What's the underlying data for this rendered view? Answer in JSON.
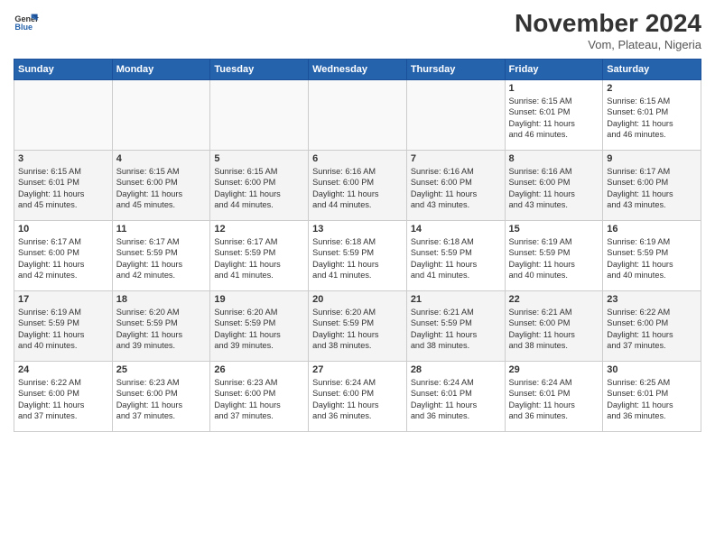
{
  "header": {
    "logo": {
      "general": "General",
      "blue": "Blue"
    },
    "month_title": "November 2024",
    "subtitle": "Vom, Plateau, Nigeria"
  },
  "weekdays": [
    "Sunday",
    "Monday",
    "Tuesday",
    "Wednesday",
    "Thursday",
    "Friday",
    "Saturday"
  ],
  "weeks": [
    [
      {
        "day": "",
        "info": ""
      },
      {
        "day": "",
        "info": ""
      },
      {
        "day": "",
        "info": ""
      },
      {
        "day": "",
        "info": ""
      },
      {
        "day": "",
        "info": ""
      },
      {
        "day": "1",
        "info": "Sunrise: 6:15 AM\nSunset: 6:01 PM\nDaylight: 11 hours\nand 46 minutes."
      },
      {
        "day": "2",
        "info": "Sunrise: 6:15 AM\nSunset: 6:01 PM\nDaylight: 11 hours\nand 46 minutes."
      }
    ],
    [
      {
        "day": "3",
        "info": "Sunrise: 6:15 AM\nSunset: 6:01 PM\nDaylight: 11 hours\nand 45 minutes."
      },
      {
        "day": "4",
        "info": "Sunrise: 6:15 AM\nSunset: 6:00 PM\nDaylight: 11 hours\nand 45 minutes."
      },
      {
        "day": "5",
        "info": "Sunrise: 6:15 AM\nSunset: 6:00 PM\nDaylight: 11 hours\nand 44 minutes."
      },
      {
        "day": "6",
        "info": "Sunrise: 6:16 AM\nSunset: 6:00 PM\nDaylight: 11 hours\nand 44 minutes."
      },
      {
        "day": "7",
        "info": "Sunrise: 6:16 AM\nSunset: 6:00 PM\nDaylight: 11 hours\nand 43 minutes."
      },
      {
        "day": "8",
        "info": "Sunrise: 6:16 AM\nSunset: 6:00 PM\nDaylight: 11 hours\nand 43 minutes."
      },
      {
        "day": "9",
        "info": "Sunrise: 6:17 AM\nSunset: 6:00 PM\nDaylight: 11 hours\nand 43 minutes."
      }
    ],
    [
      {
        "day": "10",
        "info": "Sunrise: 6:17 AM\nSunset: 6:00 PM\nDaylight: 11 hours\nand 42 minutes."
      },
      {
        "day": "11",
        "info": "Sunrise: 6:17 AM\nSunset: 5:59 PM\nDaylight: 11 hours\nand 42 minutes."
      },
      {
        "day": "12",
        "info": "Sunrise: 6:17 AM\nSunset: 5:59 PM\nDaylight: 11 hours\nand 41 minutes."
      },
      {
        "day": "13",
        "info": "Sunrise: 6:18 AM\nSunset: 5:59 PM\nDaylight: 11 hours\nand 41 minutes."
      },
      {
        "day": "14",
        "info": "Sunrise: 6:18 AM\nSunset: 5:59 PM\nDaylight: 11 hours\nand 41 minutes."
      },
      {
        "day": "15",
        "info": "Sunrise: 6:19 AM\nSunset: 5:59 PM\nDaylight: 11 hours\nand 40 minutes."
      },
      {
        "day": "16",
        "info": "Sunrise: 6:19 AM\nSunset: 5:59 PM\nDaylight: 11 hours\nand 40 minutes."
      }
    ],
    [
      {
        "day": "17",
        "info": "Sunrise: 6:19 AM\nSunset: 5:59 PM\nDaylight: 11 hours\nand 40 minutes."
      },
      {
        "day": "18",
        "info": "Sunrise: 6:20 AM\nSunset: 5:59 PM\nDaylight: 11 hours\nand 39 minutes."
      },
      {
        "day": "19",
        "info": "Sunrise: 6:20 AM\nSunset: 5:59 PM\nDaylight: 11 hours\nand 39 minutes."
      },
      {
        "day": "20",
        "info": "Sunrise: 6:20 AM\nSunset: 5:59 PM\nDaylight: 11 hours\nand 38 minutes."
      },
      {
        "day": "21",
        "info": "Sunrise: 6:21 AM\nSunset: 5:59 PM\nDaylight: 11 hours\nand 38 minutes."
      },
      {
        "day": "22",
        "info": "Sunrise: 6:21 AM\nSunset: 6:00 PM\nDaylight: 11 hours\nand 38 minutes."
      },
      {
        "day": "23",
        "info": "Sunrise: 6:22 AM\nSunset: 6:00 PM\nDaylight: 11 hours\nand 37 minutes."
      }
    ],
    [
      {
        "day": "24",
        "info": "Sunrise: 6:22 AM\nSunset: 6:00 PM\nDaylight: 11 hours\nand 37 minutes."
      },
      {
        "day": "25",
        "info": "Sunrise: 6:23 AM\nSunset: 6:00 PM\nDaylight: 11 hours\nand 37 minutes."
      },
      {
        "day": "26",
        "info": "Sunrise: 6:23 AM\nSunset: 6:00 PM\nDaylight: 11 hours\nand 37 minutes."
      },
      {
        "day": "27",
        "info": "Sunrise: 6:24 AM\nSunset: 6:00 PM\nDaylight: 11 hours\nand 36 minutes."
      },
      {
        "day": "28",
        "info": "Sunrise: 6:24 AM\nSunset: 6:01 PM\nDaylight: 11 hours\nand 36 minutes."
      },
      {
        "day": "29",
        "info": "Sunrise: 6:24 AM\nSunset: 6:01 PM\nDaylight: 11 hours\nand 36 minutes."
      },
      {
        "day": "30",
        "info": "Sunrise: 6:25 AM\nSunset: 6:01 PM\nDaylight: 11 hours\nand 36 minutes."
      }
    ]
  ]
}
